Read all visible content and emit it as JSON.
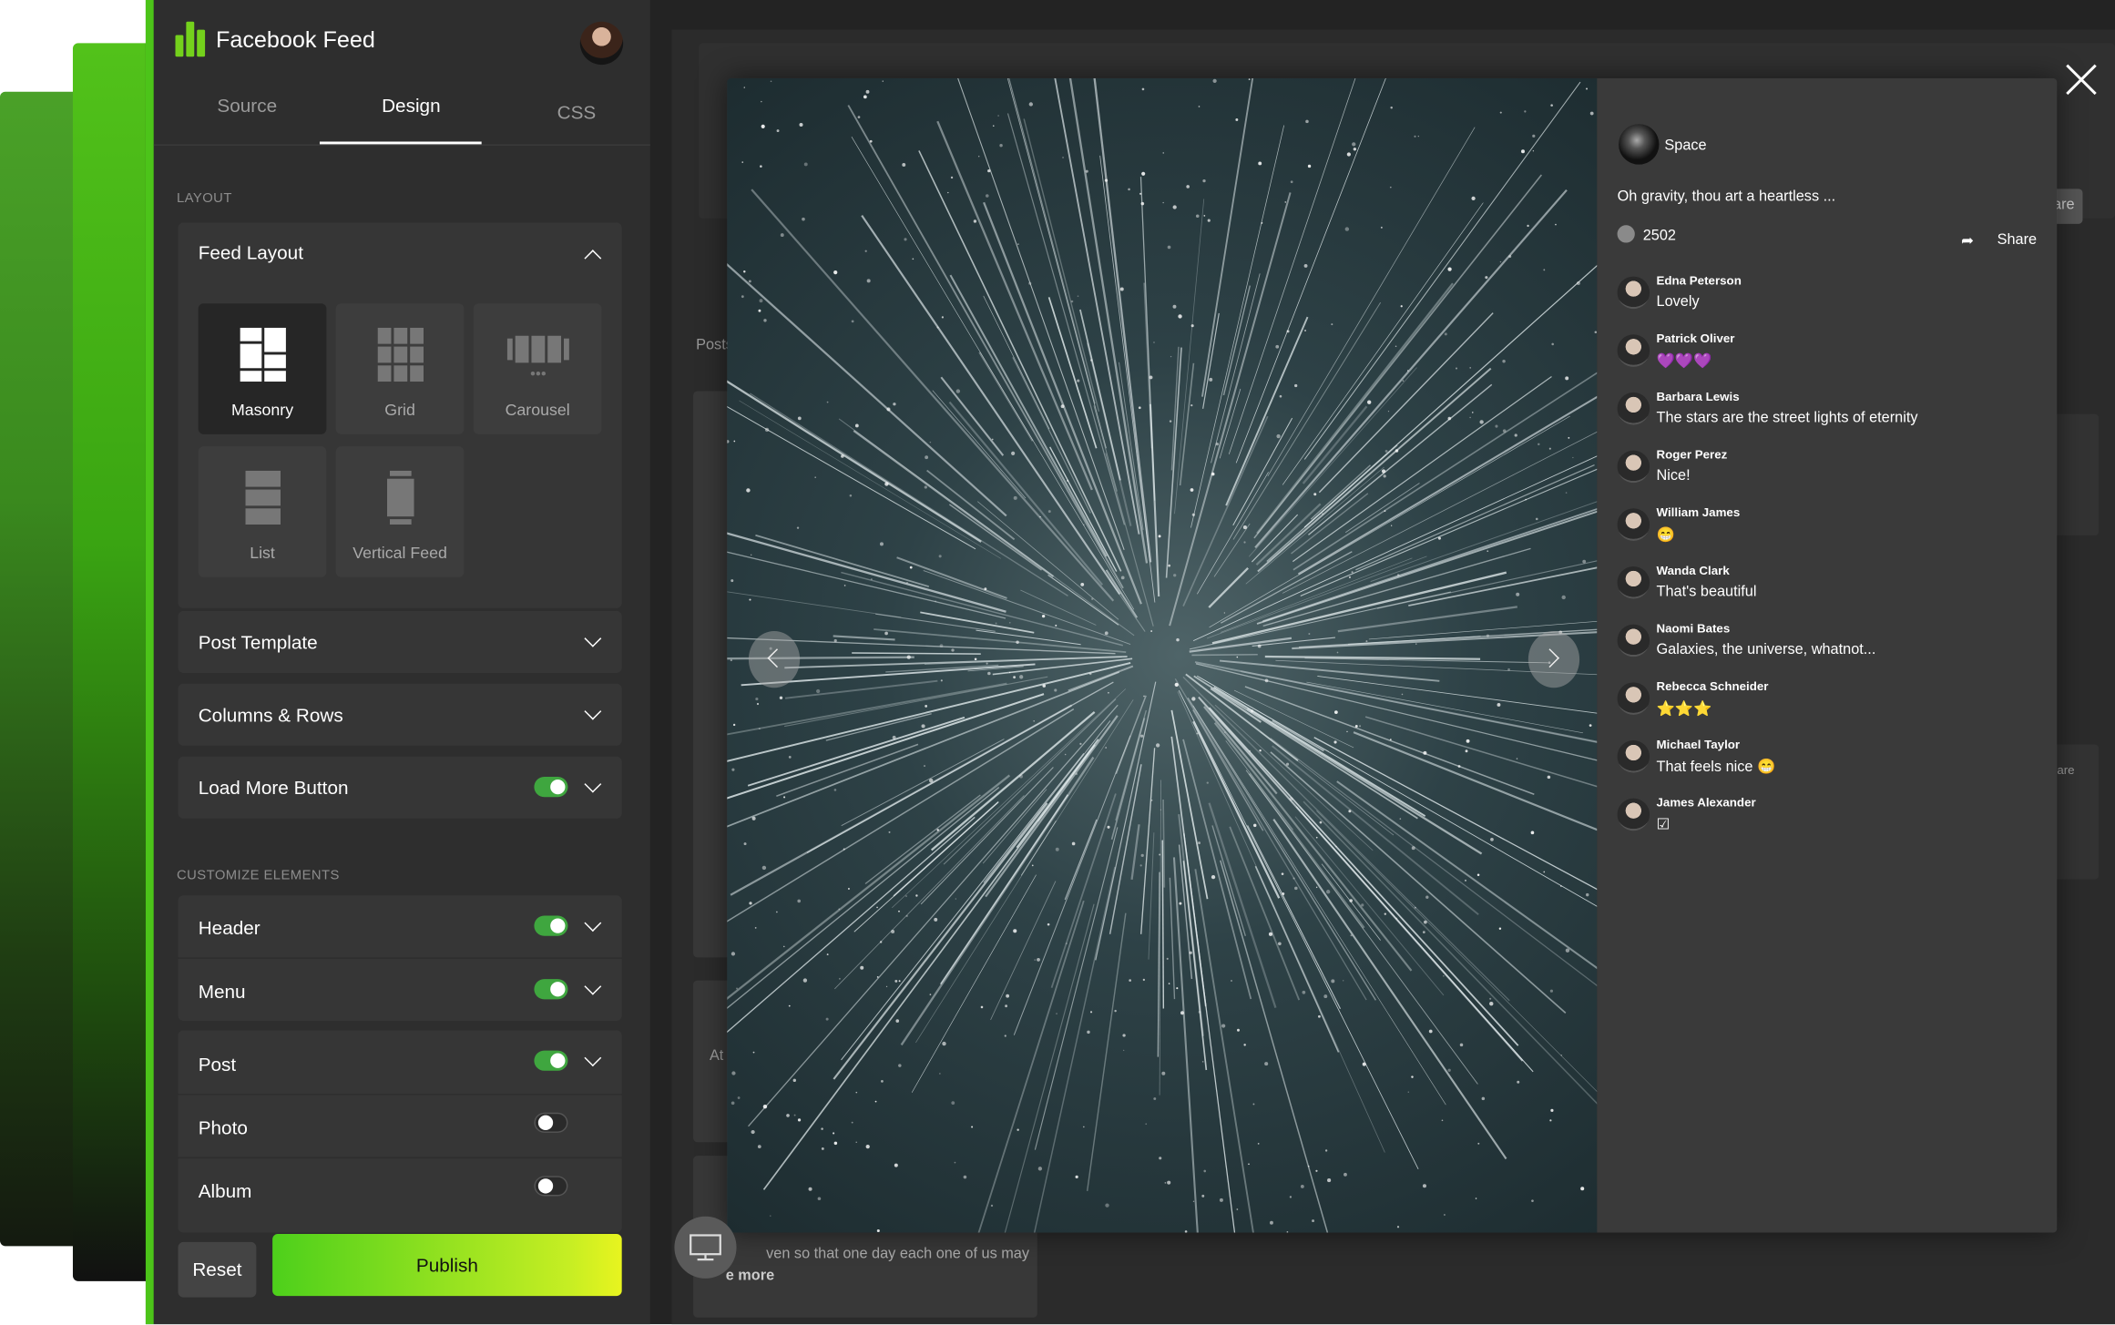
{
  "app": {
    "title": "Facebook Feed"
  },
  "tabs": [
    "Source",
    "Design",
    "CSS"
  ],
  "sections": {
    "layout": "LAYOUT",
    "customize": "CUSTOMIZE ELEMENTS"
  },
  "feed_layout": {
    "title": "Feed Layout",
    "options": [
      "Masonry",
      "Grid",
      "Carousel",
      "List",
      "Vertical Feed"
    ],
    "selected": "Masonry"
  },
  "accordions": {
    "post_template": "Post Template",
    "columns_rows": "Columns & Rows",
    "load_more": "Load More Button"
  },
  "elements": {
    "header": "Header",
    "menu": "Menu",
    "post": "Post",
    "photo": "Photo",
    "album": "Album"
  },
  "actions": {
    "reset": "Reset",
    "publish": "Publish"
  },
  "preview": {
    "posts_tab": "Posts",
    "snippet": "ven so that one day each one of us may",
    "see_more": "e more",
    "at": "At n",
    "share_ghost": "hare"
  },
  "lightbox": {
    "author": "Space",
    "text": "Oh gravity, thou art a heartless ...",
    "likes": "2502",
    "share": "Share",
    "comments": [
      {
        "name": "Edna Peterson",
        "text": "Lovely"
      },
      {
        "name": "Patrick Oliver",
        "text": "💜💜💜"
      },
      {
        "name": "Barbara Lewis",
        "text": "The stars are the street lights of eternity"
      },
      {
        "name": "Roger Perez",
        "text": "Nice!"
      },
      {
        "name": "William James",
        "text": "😁"
      },
      {
        "name": "Wanda Clark",
        "text": "That's beautiful"
      },
      {
        "name": "Naomi Bates",
        "text": "Galaxies, the universe, whatnot..."
      },
      {
        "name": "Rebecca Schneider",
        "text": "⭐⭐⭐"
      },
      {
        "name": "Michael Taylor",
        "text": "That feels nice 😁"
      },
      {
        "name": "James Alexander",
        "text": "☑"
      }
    ]
  }
}
